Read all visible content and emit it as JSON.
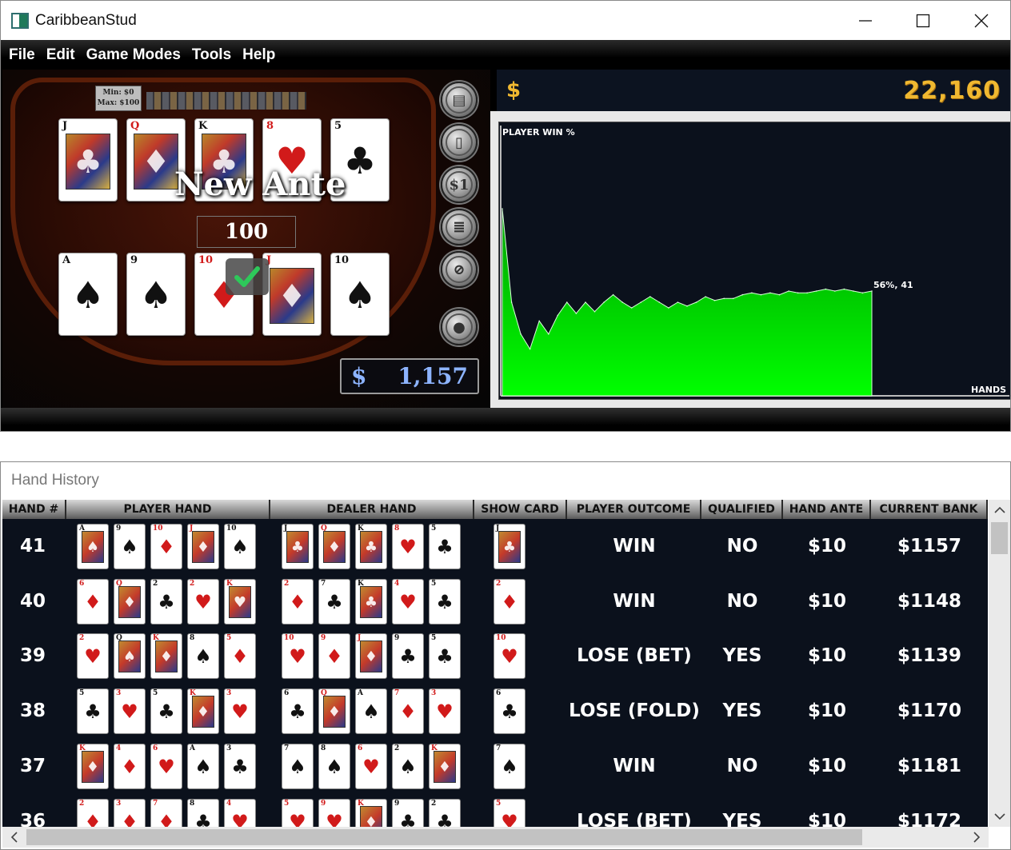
{
  "window": {
    "title": "CaribbeanStud"
  },
  "menu": [
    "File",
    "Edit",
    "Game Modes",
    "Tools",
    "Help"
  ],
  "table": {
    "limits_min": "Min: $0",
    "limits_max": "Max: $100",
    "dealer_cards": [
      {
        "rank": "J",
        "suit": "♣",
        "color": "black",
        "face": true
      },
      {
        "rank": "Q",
        "suit": "♦",
        "color": "red",
        "face": true
      },
      {
        "rank": "K",
        "suit": "♣",
        "color": "black",
        "face": true
      },
      {
        "rank": "8",
        "suit": "♥",
        "color": "red",
        "face": false
      },
      {
        "rank": "5",
        "suit": "♣",
        "color": "black",
        "face": false
      }
    ],
    "player_cards": [
      {
        "rank": "A",
        "suit": "♠",
        "color": "black",
        "face": false
      },
      {
        "rank": "9",
        "suit": "♠",
        "color": "black",
        "face": false
      },
      {
        "rank": "10",
        "suit": "♦",
        "color": "red",
        "face": false
      },
      {
        "rank": "J",
        "suit": "♦",
        "color": "red",
        "face": true
      },
      {
        "rank": "10",
        "suit": "♠",
        "color": "black",
        "face": false
      }
    ],
    "new_ante_label": "New Ante",
    "ante_value": "100",
    "bank_symbol": "$",
    "bank_value": "1,157",
    "side_buttons": [
      "deal-cards-icon",
      "single-card-icon",
      "one-dollar-icon",
      "chip-stack-icon",
      "no-bet-icon",
      "coin-icon"
    ]
  },
  "bank": {
    "symbol": "$",
    "value": "22,160"
  },
  "chart_data": {
    "type": "area",
    "title": "PLAYER WIN %",
    "xlabel": "HANDS",
    "ylabel": "",
    "annotation": "56%, 41",
    "x": [
      1,
      2,
      3,
      4,
      5,
      6,
      7,
      8,
      9,
      10,
      11,
      12,
      13,
      14,
      15,
      16,
      17,
      18,
      19,
      20,
      21,
      22,
      23,
      24,
      25,
      26,
      27,
      28,
      29,
      30,
      31,
      32,
      33,
      34,
      35,
      36,
      37,
      38,
      39,
      40,
      41
    ],
    "values": [
      100,
      50,
      33,
      25,
      40,
      33,
      43,
      50,
      44,
      50,
      45,
      50,
      54,
      50,
      47,
      50,
      53,
      50,
      47,
      50,
      48,
      50,
      53,
      51,
      52,
      52,
      54,
      55,
      54,
      55,
      54,
      56,
      55,
      55,
      56,
      57,
      56,
      57,
      56,
      55,
      56
    ],
    "ylim": [
      0,
      100
    ],
    "color": "#00ff00"
  },
  "history": {
    "title": "Hand History",
    "columns": [
      "HAND #",
      "PLAYER HAND",
      "DEALER HAND",
      "SHOW CARD",
      "PLAYER OUTCOME",
      "QUALIFIED",
      "HAND ANTE",
      "CURRENT BANK"
    ],
    "rows": [
      {
        "hand": "41",
        "outcome": "WIN",
        "qualified": "NO",
        "ante": "$10",
        "bank": "$1157",
        "player": [
          [
            "A",
            "♠",
            "b",
            1
          ],
          [
            "9",
            "♠",
            "b",
            0
          ],
          [
            "10",
            "♦",
            "r",
            0
          ],
          [
            "J",
            "♦",
            "r",
            1
          ],
          [
            "10",
            "♠",
            "b",
            0
          ]
        ],
        "dealer": [
          [
            "J",
            "♣",
            "b",
            1
          ],
          [
            "Q",
            "♦",
            "r",
            1
          ],
          [
            "K",
            "♣",
            "b",
            1
          ],
          [
            "8",
            "♥",
            "r",
            0
          ],
          [
            "5",
            "♣",
            "b",
            0
          ]
        ],
        "show": [
          "J",
          "♣",
          "b",
          1
        ]
      },
      {
        "hand": "40",
        "outcome": "WIN",
        "qualified": "NO",
        "ante": "$10",
        "bank": "$1148",
        "player": [
          [
            "6",
            "♦",
            "r",
            0
          ],
          [
            "Q",
            "♦",
            "r",
            1
          ],
          [
            "2",
            "♣",
            "b",
            0
          ],
          [
            "2",
            "♥",
            "r",
            0
          ],
          [
            "K",
            "♥",
            "r",
            1
          ]
        ],
        "dealer": [
          [
            "2",
            "♦",
            "r",
            0
          ],
          [
            "7",
            "♣",
            "b",
            0
          ],
          [
            "K",
            "♣",
            "b",
            1
          ],
          [
            "4",
            "♥",
            "r",
            0
          ],
          [
            "5",
            "♣",
            "b",
            0
          ]
        ],
        "show": [
          "2",
          "♦",
          "r",
          0
        ]
      },
      {
        "hand": "39",
        "outcome": "LOSE (BET)",
        "qualified": "YES",
        "ante": "$10",
        "bank": "$1139",
        "player": [
          [
            "2",
            "♥",
            "r",
            0
          ],
          [
            "Q",
            "♠",
            "b",
            1
          ],
          [
            "K",
            "♦",
            "r",
            1
          ],
          [
            "8",
            "♠",
            "b",
            0
          ],
          [
            "5",
            "♦",
            "r",
            0
          ]
        ],
        "dealer": [
          [
            "10",
            "♥",
            "r",
            0
          ],
          [
            "9",
            "♦",
            "r",
            0
          ],
          [
            "J",
            "♦",
            "r",
            1
          ],
          [
            "9",
            "♣",
            "b",
            0
          ],
          [
            "5",
            "♣",
            "b",
            0
          ]
        ],
        "show": [
          "10",
          "♥",
          "r",
          0
        ]
      },
      {
        "hand": "38",
        "outcome": "LOSE (FOLD)",
        "qualified": "YES",
        "ante": "$10",
        "bank": "$1170",
        "player": [
          [
            "5",
            "♣",
            "b",
            0
          ],
          [
            "3",
            "♥",
            "r",
            0
          ],
          [
            "5",
            "♣",
            "b",
            0
          ],
          [
            "K",
            "♦",
            "r",
            1
          ],
          [
            "3",
            "♥",
            "r",
            0
          ]
        ],
        "dealer": [
          [
            "6",
            "♣",
            "b",
            0
          ],
          [
            "Q",
            "♦",
            "r",
            1
          ],
          [
            "A",
            "♠",
            "b",
            0
          ],
          [
            "7",
            "♦",
            "r",
            0
          ],
          [
            "3",
            "♥",
            "r",
            0
          ]
        ],
        "show": [
          "6",
          "♣",
          "b",
          0
        ]
      },
      {
        "hand": "37",
        "outcome": "WIN",
        "qualified": "NO",
        "ante": "$10",
        "bank": "$1181",
        "player": [
          [
            "K",
            "♦",
            "r",
            1
          ],
          [
            "4",
            "♦",
            "r",
            0
          ],
          [
            "6",
            "♥",
            "r",
            0
          ],
          [
            "A",
            "♠",
            "b",
            0
          ],
          [
            "3",
            "♣",
            "b",
            0
          ]
        ],
        "dealer": [
          [
            "7",
            "♠",
            "b",
            0
          ],
          [
            "8",
            "♠",
            "b",
            0
          ],
          [
            "6",
            "♥",
            "r",
            0
          ],
          [
            "2",
            "♠",
            "b",
            0
          ],
          [
            "K",
            "♦",
            "r",
            1
          ]
        ],
        "show": [
          "7",
          "♠",
          "b",
          0
        ]
      },
      {
        "hand": "36",
        "outcome": "LOSE (BET)",
        "qualified": "YES",
        "ante": "$10",
        "bank": "$1172",
        "player": [
          [
            "2",
            "♦",
            "r",
            0
          ],
          [
            "3",
            "♦",
            "r",
            0
          ],
          [
            "7",
            "♦",
            "r",
            0
          ],
          [
            "8",
            "♣",
            "b",
            0
          ],
          [
            "4",
            "♥",
            "r",
            0
          ]
        ],
        "dealer": [
          [
            "5",
            "♥",
            "r",
            0
          ],
          [
            "9",
            "♥",
            "r",
            0
          ],
          [
            "K",
            "♦",
            "r",
            1
          ],
          [
            "9",
            "♣",
            "b",
            0
          ],
          [
            "2",
            "♣",
            "b",
            0
          ]
        ],
        "show": [
          "5",
          "♥",
          "r",
          0
        ]
      }
    ]
  }
}
